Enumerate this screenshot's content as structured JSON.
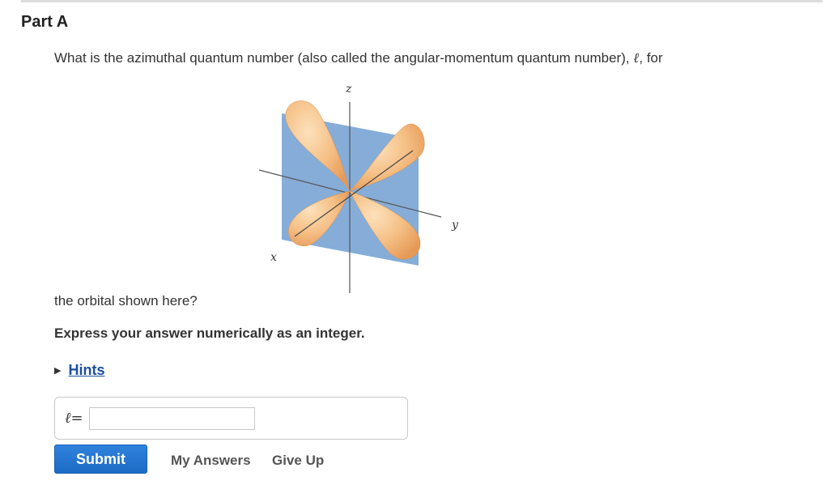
{
  "part": {
    "title": "Part A"
  },
  "question": {
    "text_before": "What is the azimuthal quantum number (also called the angular-momentum quantum number), ",
    "symbol": "ℓ",
    "text_after": ", for",
    "continuation": "the orbital shown here?"
  },
  "figure": {
    "axis_z": "z",
    "axis_y": "y",
    "axis_x": "x",
    "colors": {
      "plane": "#7fa9d6",
      "lobe": "#f2b679",
      "lobe_highlight": "#fde1bc"
    }
  },
  "instruction": "Express your answer numerically as an integer.",
  "hints": {
    "label": "Hints",
    "icon": "triangle-right-icon"
  },
  "answer": {
    "label": "ℓ=",
    "value": ""
  },
  "buttons": {
    "submit": "Submit",
    "my_answers": "My Answers",
    "give_up": "Give Up"
  },
  "colors": {
    "submit_bg": "#2a7ad6",
    "link": "#1a4f9c"
  }
}
